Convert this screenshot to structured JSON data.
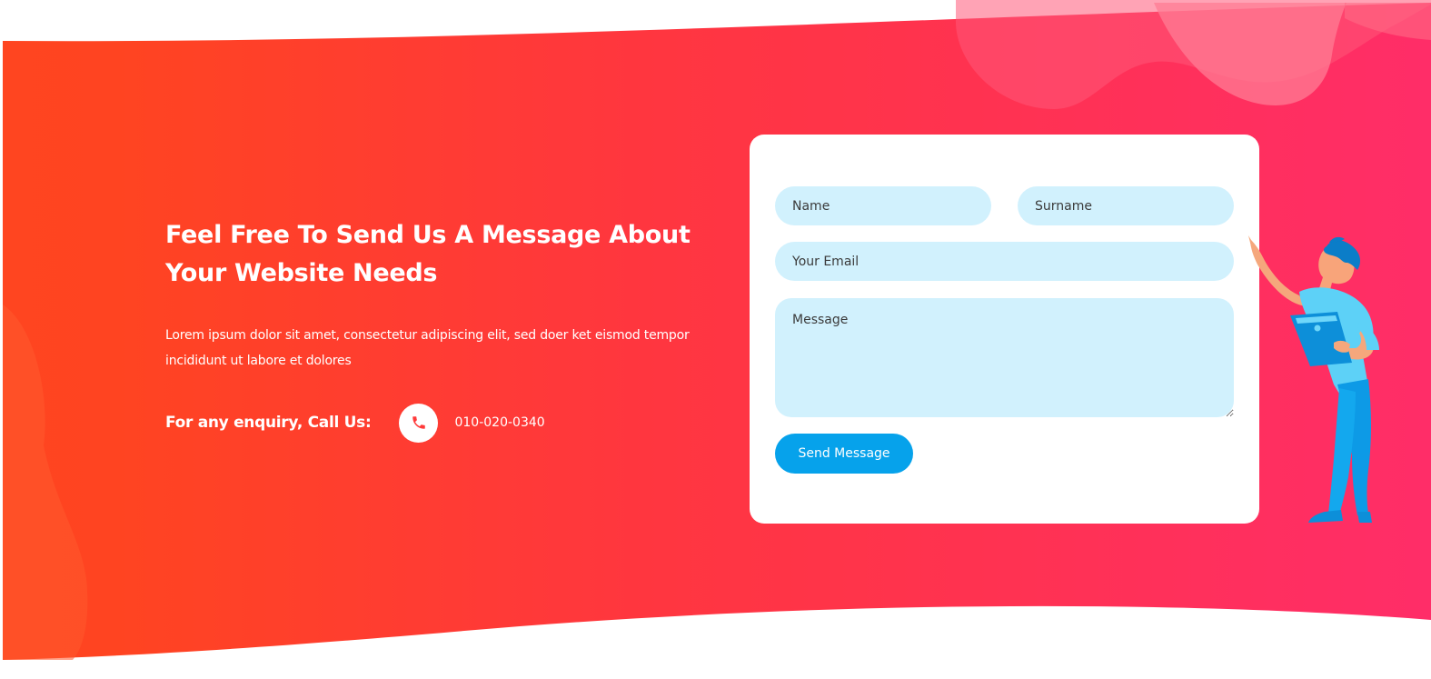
{
  "hero": {
    "headline_line1": "Feel Free To Send Us A Message About",
    "headline_line2": "Your Website Needs",
    "body_line1": "Lorem ipsum dolor sit amet, consectetur adipiscing elit, sed doer ket eismod tempor",
    "body_line2": "incididunt ut labore et dolores"
  },
  "enquiry": {
    "label": "For any enquiry, Call Us:",
    "phone": "010-020-0340",
    "icon": "phone-icon"
  },
  "form": {
    "name_placeholder": "Name",
    "surname_placeholder": "Surname",
    "email_placeholder": "Your Email",
    "message_placeholder": "Message",
    "submit_label": "Send Message"
  },
  "colors": {
    "gradient_start": "#ff4520",
    "gradient_end": "#ff2d68",
    "field_bg": "#d1f1fd",
    "button_bg": "#06a2eb",
    "phone_icon": "#ff3a3a"
  }
}
